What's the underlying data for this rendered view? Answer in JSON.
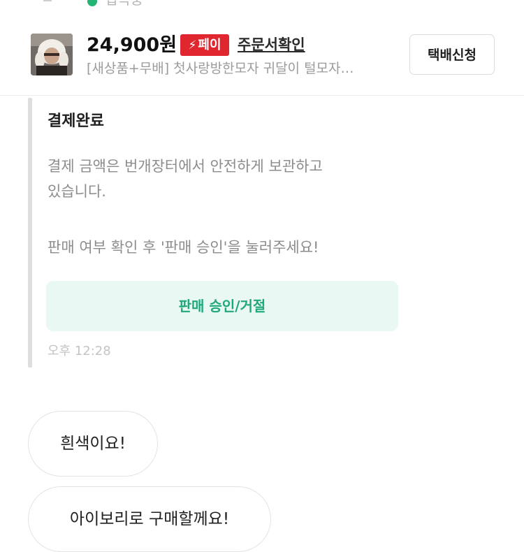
{
  "status": {
    "text": "접속중",
    "color": "#22b573"
  },
  "product": {
    "image": "fur-hat-product-photo",
    "price": "24,900원",
    "pay_badge": {
      "icon": "lightning-icon",
      "label": "페이",
      "color": "#e0262f"
    },
    "order_link": "주문서확인",
    "title": "[새상품+무배] 첫사랑방한모자 귀달이 털모자…",
    "ship_button": "택배신청"
  },
  "notice": {
    "title": "결제완료",
    "body_line1": "결제 금액은 번개장터에서 안전하게 보관하고",
    "body_line2": "있습니다.",
    "body_line3": "판매 여부 확인 후 '판매 승인'을 눌러주세요!",
    "action_button": "판매 승인/거절",
    "action_color": "#1fa97a",
    "time": "오후 12:28"
  },
  "messages": [
    {
      "text": "흰색이요!"
    },
    {
      "text": "아이보리로 구매할께요!"
    }
  ]
}
